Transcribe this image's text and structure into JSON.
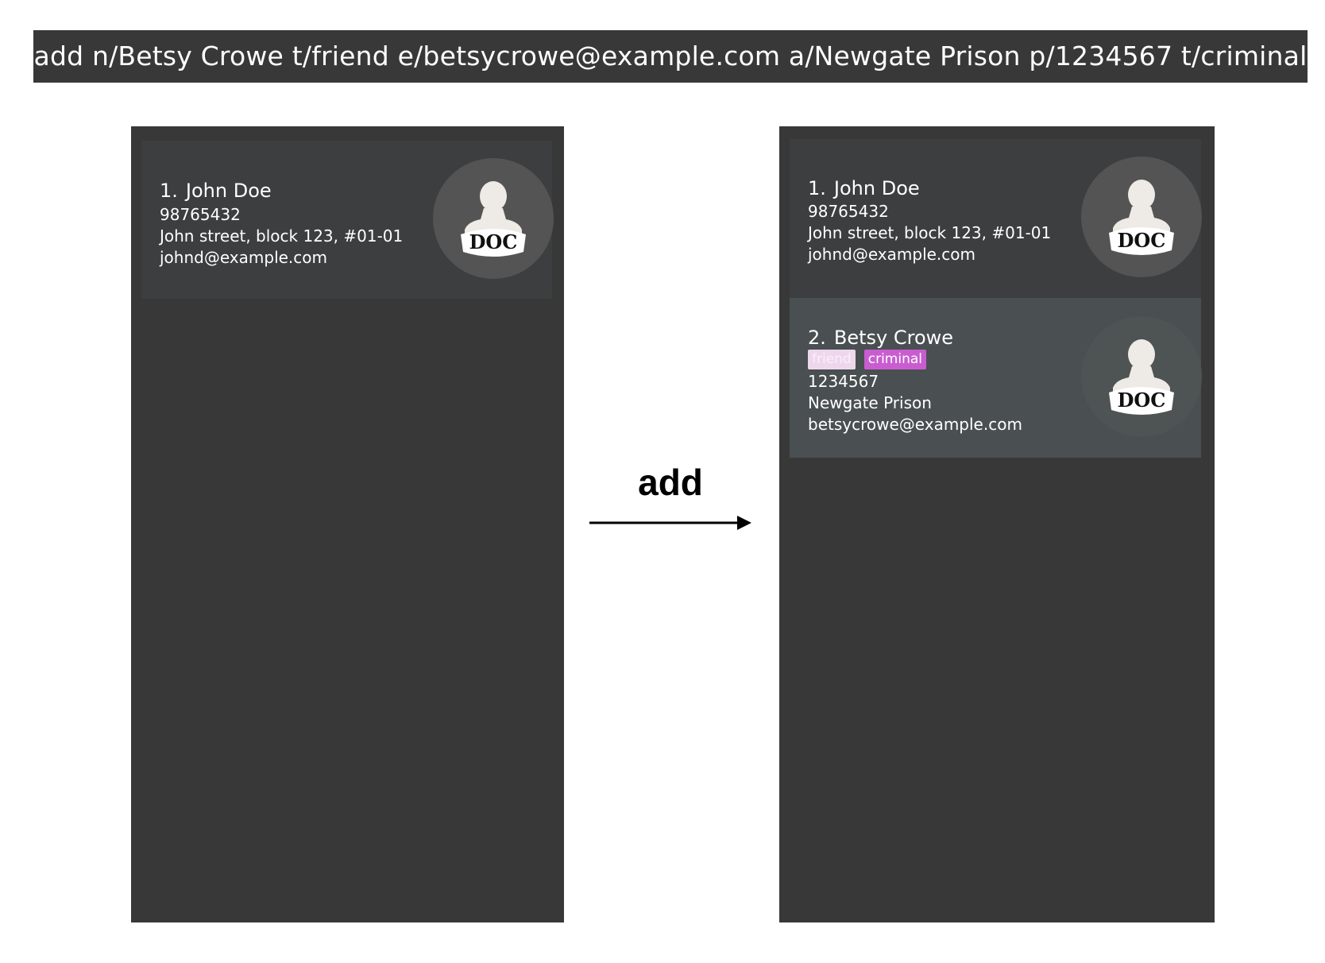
{
  "command": {
    "text": "add n/Betsy Crowe t/friend e/betsycrowe@example.com a/Newgate Prison p/1234567 t/criminal"
  },
  "arrow": {
    "label": "add"
  },
  "before": {
    "persons": [
      {
        "index": "1.",
        "name": "John Doe",
        "phone": "98765432",
        "address": "John street, block 123, #01-01",
        "email": "johnd@example.com",
        "avatar_label": "DOC"
      }
    ]
  },
  "after": {
    "persons": [
      {
        "index": "1.",
        "name": "John Doe",
        "phone": "98765432",
        "address": "John street, block 123, #01-01",
        "email": "johnd@example.com",
        "avatar_label": "DOC"
      },
      {
        "index": "2.",
        "name": "Betsy Crowe",
        "tags": [
          "friend",
          "criminal"
        ],
        "phone": "1234567",
        "address": "Newgate Prison",
        "email": "betsycrowe@example.com",
        "avatar_label": "DOC"
      }
    ]
  },
  "colors": {
    "panel": "#383838",
    "card": "#3c3e3f",
    "card_selected": "#4a4f51",
    "tag_friend": "#eed7ec",
    "tag_criminal": "#c95dd0"
  }
}
